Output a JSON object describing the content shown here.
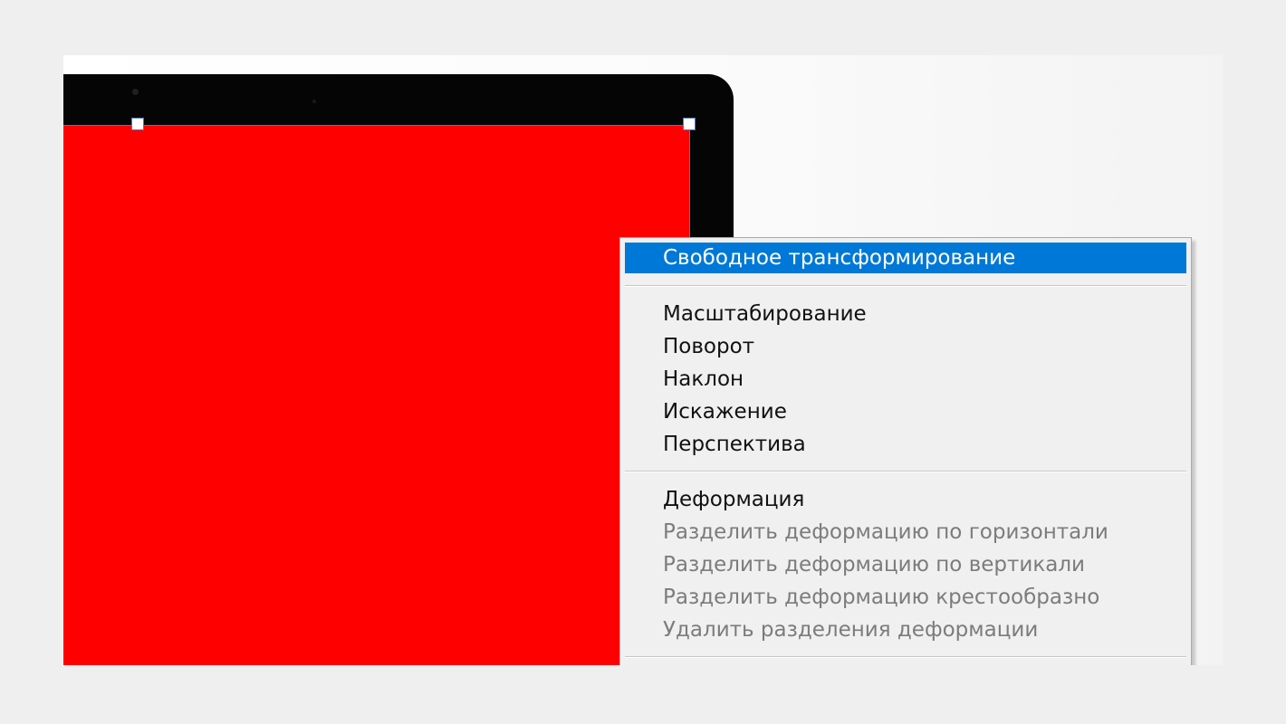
{
  "context_menu": {
    "items": [
      {
        "label": "Свободное трансформирование",
        "state": "highlighted"
      },
      {
        "label": "Масштабирование",
        "state": "enabled"
      },
      {
        "label": "Поворот",
        "state": "enabled"
      },
      {
        "label": "Наклон",
        "state": "enabled"
      },
      {
        "label": "Искажение",
        "state": "enabled"
      },
      {
        "label": "Перспектива",
        "state": "enabled"
      },
      {
        "label": "Деформация",
        "state": "enabled"
      },
      {
        "label": "Разделить деформацию по горизонтали",
        "state": "disabled"
      },
      {
        "label": "Разделить деформацию по вертикали",
        "state": "disabled"
      },
      {
        "label": "Разделить деформацию крестообразно",
        "state": "disabled"
      },
      {
        "label": "Удалить разделения деформации",
        "state": "disabled"
      }
    ]
  },
  "colors": {
    "highlight": "#0078d7",
    "layer_fill": "#ff0000",
    "selection_border": "#4c73d8",
    "menu_background": "#f0f0f0"
  }
}
